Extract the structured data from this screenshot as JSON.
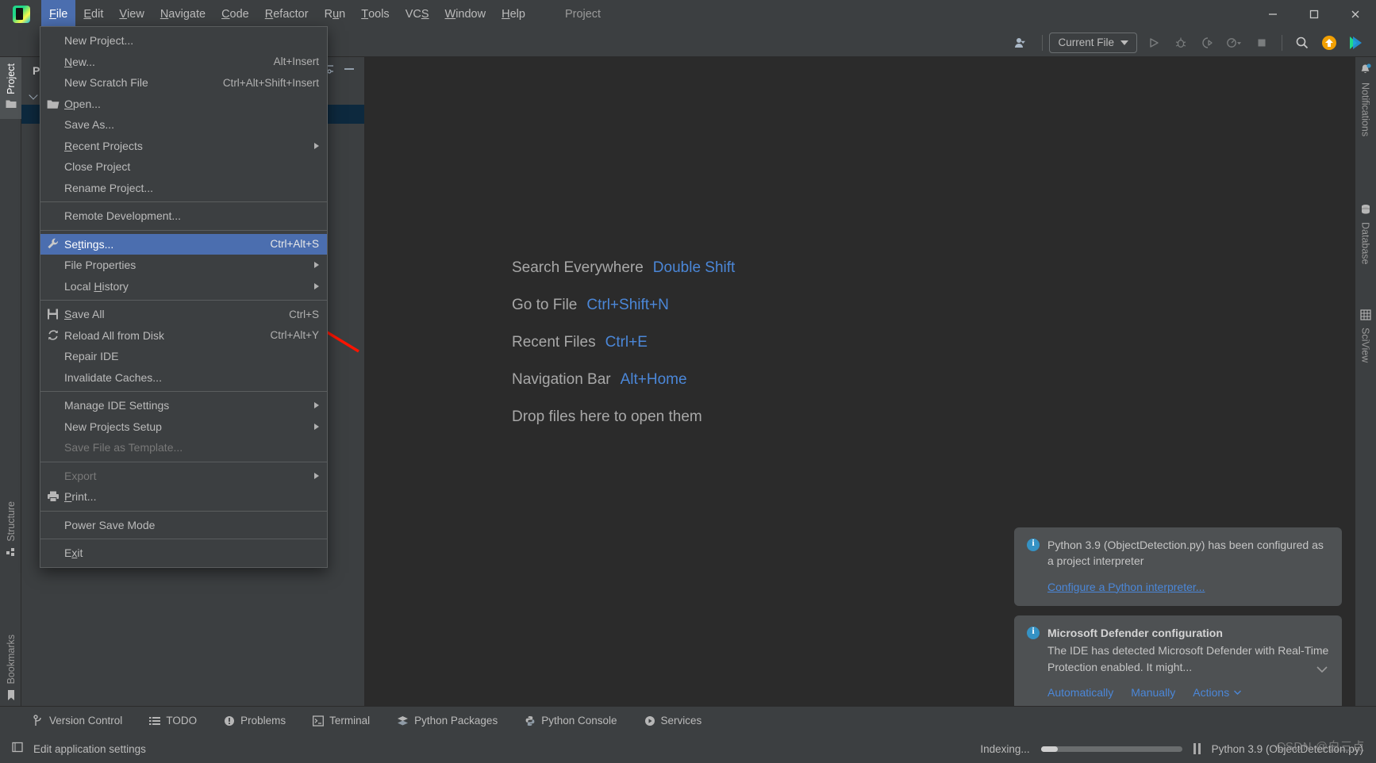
{
  "window": {
    "project_title": "Project",
    "minimize_label": "Minimize",
    "maximize_label": "Maximize",
    "close_label": "Close"
  },
  "menubar": [
    {
      "label": "File",
      "mnemonic": "F",
      "active": true
    },
    {
      "label": "Edit",
      "mnemonic": "E",
      "active": false
    },
    {
      "label": "View",
      "mnemonic": "V",
      "active": false
    },
    {
      "label": "Navigate",
      "mnemonic": "N",
      "active": false
    },
    {
      "label": "Code",
      "mnemonic": "C",
      "active": false
    },
    {
      "label": "Refactor",
      "mnemonic": "R",
      "active": false
    },
    {
      "label": "Run",
      "mnemonic": "u",
      "active": false
    },
    {
      "label": "Tools",
      "mnemonic": "T",
      "active": false
    },
    {
      "label": "VCS",
      "mnemonic": "S",
      "active": false
    },
    {
      "label": "Window",
      "mnemonic": "W",
      "active": false
    },
    {
      "label": "Help",
      "mnemonic": "H",
      "active": false
    }
  ],
  "file_menu": {
    "items": [
      {
        "label": "New Project...",
        "shortcut": "",
        "icon": "",
        "type": "item"
      },
      {
        "label": "New...",
        "shortcut": "Alt+Insert",
        "icon": "",
        "type": "item",
        "mnemonic": "N"
      },
      {
        "label": "New Scratch File",
        "shortcut": "Ctrl+Alt+Shift+Insert",
        "icon": "",
        "type": "item"
      },
      {
        "label": "Open...",
        "shortcut": "",
        "icon": "folder-icon",
        "type": "item",
        "mnemonic": "O"
      },
      {
        "label": "Save As...",
        "shortcut": "",
        "icon": "",
        "type": "item"
      },
      {
        "label": "Recent Projects",
        "shortcut": "",
        "icon": "",
        "type": "submenu",
        "mnemonic": "R"
      },
      {
        "label": "Close Project",
        "shortcut": "",
        "icon": "",
        "type": "item"
      },
      {
        "label": "Rename Project...",
        "shortcut": "",
        "icon": "",
        "type": "item"
      },
      {
        "type": "separator"
      },
      {
        "label": "Remote Development...",
        "shortcut": "",
        "icon": "",
        "type": "item"
      },
      {
        "type": "separator"
      },
      {
        "label": "Settings...",
        "shortcut": "Ctrl+Alt+S",
        "icon": "wrench-icon",
        "type": "item",
        "selected": true,
        "mnemonic": "t"
      },
      {
        "label": "File Properties",
        "shortcut": "",
        "icon": "",
        "type": "submenu"
      },
      {
        "label": "Local History",
        "shortcut": "",
        "icon": "",
        "type": "submenu",
        "mnemonic": "H"
      },
      {
        "type": "separator"
      },
      {
        "label": "Save All",
        "shortcut": "Ctrl+S",
        "icon": "save-icon",
        "type": "item",
        "mnemonic": "S"
      },
      {
        "label": "Reload All from Disk",
        "shortcut": "Ctrl+Alt+Y",
        "icon": "reload-icon",
        "type": "item"
      },
      {
        "label": "Repair IDE",
        "shortcut": "",
        "icon": "",
        "type": "item"
      },
      {
        "label": "Invalidate Caches...",
        "shortcut": "",
        "icon": "",
        "type": "item"
      },
      {
        "type": "separator"
      },
      {
        "label": "Manage IDE Settings",
        "shortcut": "",
        "icon": "",
        "type": "submenu"
      },
      {
        "label": "New Projects Setup",
        "shortcut": "",
        "icon": "",
        "type": "submenu"
      },
      {
        "label": "Save File as Template...",
        "shortcut": "",
        "icon": "",
        "type": "item",
        "disabled": true
      },
      {
        "type": "separator"
      },
      {
        "label": "Export",
        "shortcut": "",
        "icon": "",
        "type": "submenu",
        "disabled": true
      },
      {
        "label": "Print...",
        "shortcut": "",
        "icon": "printer-icon",
        "type": "item",
        "mnemonic": "P"
      },
      {
        "type": "separator"
      },
      {
        "label": "Power Save Mode",
        "shortcut": "",
        "icon": "",
        "type": "item"
      },
      {
        "type": "separator"
      },
      {
        "label": "Exit",
        "shortcut": "",
        "icon": "",
        "type": "item",
        "mnemonic": "x"
      }
    ]
  },
  "toolbar": {
    "run_config": "Current File",
    "icons": [
      "account-icon",
      "run-icon",
      "debug-icon",
      "run-coverage-icon",
      "profile-icon",
      "stop-icon",
      "search-icon",
      "update-icon",
      "ide-icon"
    ]
  },
  "left_strip": {
    "tabs": [
      {
        "label": "Project",
        "icon": "folder-icon",
        "active": true
      },
      {
        "label": "Structure",
        "icon": "structure-icon",
        "active": false
      },
      {
        "label": "Bookmarks",
        "icon": "bookmark-icon",
        "active": false
      }
    ]
  },
  "right_strip": {
    "tabs": [
      {
        "label": "Notifications",
        "icon": "bell-icon",
        "badge": true
      },
      {
        "label": "Database",
        "icon": "database-icon",
        "badge": false
      },
      {
        "label": "SciView",
        "icon": "grid-icon",
        "badge": false
      }
    ]
  },
  "project_panel": {
    "title": "Project",
    "tree": [
      {
        "label": "",
        "selected": false
      },
      {
        "label": "",
        "selected": true
      }
    ]
  },
  "editor": {
    "hints": [
      {
        "label": "Search Everywhere",
        "key": "Double Shift"
      },
      {
        "label": "Go to File",
        "key": "Ctrl+Shift+N"
      },
      {
        "label": "Recent Files",
        "key": "Ctrl+E"
      },
      {
        "label": "Navigation Bar",
        "key": "Alt+Home"
      },
      {
        "label": "Drop files here to open them",
        "key": ""
      }
    ]
  },
  "notifications": [
    {
      "id": "python-interpreter",
      "icon": "info-icon",
      "title": "",
      "body": "Python 3.9 (ObjectDetection.py) has been configured as a project interpreter",
      "link": "Configure a Python interpreter...",
      "actions": []
    },
    {
      "id": "microsoft-defender",
      "icon": "info-icon",
      "title": "Microsoft Defender configuration",
      "body": "The IDE has detected Microsoft Defender with Real-Time Protection enabled. It might...",
      "link": "",
      "actions": [
        "Automatically",
        "Manually",
        "Actions"
      ]
    }
  ],
  "bottom_bar": {
    "items": [
      {
        "label": "Version Control",
        "icon": "branch-icon"
      },
      {
        "label": "TODO",
        "icon": "list-icon"
      },
      {
        "label": "Problems",
        "icon": "warning-icon"
      },
      {
        "label": "Terminal",
        "icon": "terminal-icon"
      },
      {
        "label": "Python Packages",
        "icon": "packages-icon"
      },
      {
        "label": "Python Console",
        "icon": "python-icon"
      },
      {
        "label": "Services",
        "icon": "services-icon"
      }
    ]
  },
  "status_bar": {
    "left_icon": "widget-icon",
    "left_text": "Edit application settings",
    "indexing_text": "Indexing...",
    "progress_percent": 12,
    "pause_label": "Pause",
    "interpreter": "Python 3.9 (ObjectDetection.py)",
    "watermark": "CSDN @白三点"
  },
  "colors": {
    "accent_blue": "#4b6eaf",
    "link_blue": "#4b87d8",
    "panel_bg": "#3c3f41",
    "editor_bg": "#2b2b2b",
    "notification_bg": "#4e5153",
    "annotation_red": "#fe1400",
    "selection_bg": "#0d293e"
  }
}
